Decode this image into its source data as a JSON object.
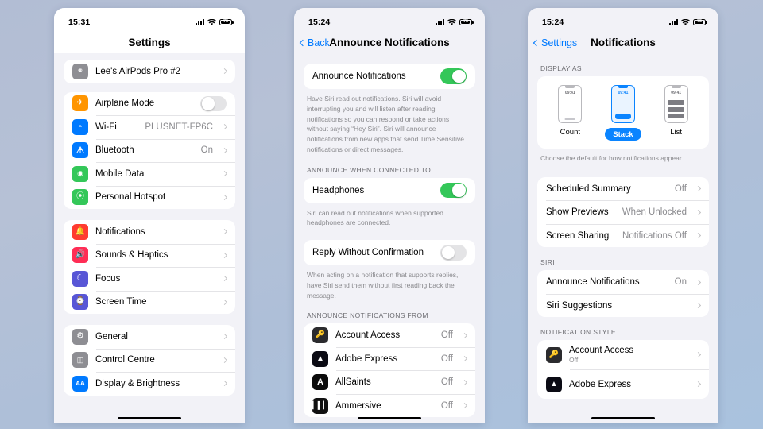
{
  "phones": [
    {
      "id": "settings-main",
      "status": {
        "time": "15:31",
        "battery": "75"
      },
      "nav": {
        "title": "Settings"
      },
      "device_card": {
        "label": "Lee's AirPods Pro #2",
        "icon": "airpods-icon"
      },
      "groups": [
        {
          "rows": [
            {
              "label": "Airplane Mode",
              "icon": "airplane-icon",
              "icon_color": "#ff9500",
              "glyph": "✈",
              "control": "switch",
              "on": false
            },
            {
              "label": "Wi-Fi",
              "icon": "wifi-icon",
              "icon_color": "#007aff",
              "glyph": "◔",
              "value": "PLUSNET-FP6C",
              "control": "chevron"
            },
            {
              "label": "Bluetooth",
              "icon": "bluetooth-icon",
              "icon_color": "#007aff",
              "glyph": "ᛗ",
              "value": "On",
              "control": "chevron"
            },
            {
              "label": "Mobile Data",
              "icon": "mobile-data-icon",
              "icon_color": "#34c759",
              "glyph": "≈",
              "value": "",
              "control": "chevron"
            },
            {
              "label": "Personal Hotspot",
              "icon": "hotspot-icon",
              "icon_color": "#34c759",
              "glyph": "@",
              "value": "",
              "control": "chevron"
            }
          ]
        },
        {
          "rows": [
            {
              "label": "Notifications",
              "icon": "notifications-bell-icon",
              "icon_color": "#ff3b30",
              "glyph": "ὑ4",
              "value": "",
              "control": "chevron"
            },
            {
              "label": "Sounds & Haptics",
              "icon": "sounds-icon",
              "icon_color": "#ff2d55",
              "glyph": "ὐA",
              "value": "",
              "control": "chevron"
            },
            {
              "label": "Focus",
              "icon": "focus-moon-icon",
              "icon_color": "#5856d6",
              "glyph": "☾",
              "value": "",
              "control": "chevron"
            },
            {
              "label": "Screen Time",
              "icon": "screen-time-icon",
              "icon_color": "#5856d6",
              "glyph": "⏳",
              "value": "",
              "control": "chevron"
            }
          ]
        },
        {
          "rows": [
            {
              "label": "General",
              "icon": "gear-icon",
              "icon_color": "#8e8e93",
              "glyph": "⚙",
              "value": "",
              "control": "chevron"
            },
            {
              "label": "Control Centre",
              "icon": "control-centre-icon",
              "icon_color": "#8e8e93",
              "glyph": "☰",
              "value": "",
              "control": "chevron"
            },
            {
              "label": "Display & Brightness",
              "icon": "display-brightness-icon",
              "icon_color": "#007aff",
              "glyph": "AA",
              "value": "",
              "control": "chevron"
            }
          ]
        }
      ]
    },
    {
      "id": "announce-notifications",
      "status": {
        "time": "15:24",
        "battery": "75"
      },
      "nav": {
        "back_label": "Back",
        "title": "Announce Notifications"
      },
      "main_toggle": {
        "label": "Announce Notifications",
        "on": true
      },
      "main_footnote": "Have Siri read out notifications. Siri will avoid interrupting you and will listen after reading notifications so you can respond or take actions without saying “Hey Siri”. Siri will announce notifications from new apps that send Time Sensitive notifications or direct messages.",
      "connected_header": "ANNOUNCE WHEN CONNECTED TO",
      "headphones": {
        "label": "Headphones",
        "on": true
      },
      "headphones_footnote": "Siri can read out notifications when supported headphones are connected.",
      "reply": {
        "label": "Reply Without Confirmation",
        "on": false
      },
      "reply_footnote": "When acting on a notification that supports replies, have Siri send them without first reading back the message.",
      "apps_header": "ANNOUNCE NOTIFICATIONS FROM",
      "apps": [
        {
          "label": "Account Access",
          "value": "Off",
          "icon": "account-access-app-icon"
        },
        {
          "label": "Adobe Express",
          "value": "Off",
          "icon": "adobe-express-app-icon"
        },
        {
          "label": "AllSaints",
          "value": "Off",
          "icon": "allsaints-app-icon"
        },
        {
          "label": "Ammersive",
          "value": "Off",
          "icon": "ammersive-app-icon"
        }
      ]
    },
    {
      "id": "notifications",
      "status": {
        "time": "15:24",
        "battery": "75"
      },
      "nav": {
        "back_label": "Settings",
        "title": "Notifications"
      },
      "display_as_header": "DISPLAY AS",
      "display_as_options": [
        {
          "label": "Count",
          "time": "09:41",
          "selected": false
        },
        {
          "label": "Stack",
          "time": "09:41",
          "selected": true
        },
        {
          "label": "List",
          "time": "09:41",
          "selected": false
        }
      ],
      "display_as_footnote": "Choose the default for how notifications appear.",
      "settings_rows": [
        {
          "label": "Scheduled Summary",
          "value": "Off"
        },
        {
          "label": "Show Previews",
          "value": "When Unlocked"
        },
        {
          "label": "Screen Sharing",
          "value": "Notifications Off"
        }
      ],
      "siri_header": "SIRI",
      "siri_rows": [
        {
          "label": "Announce Notifications",
          "value": "On"
        },
        {
          "label": "Siri Suggestions",
          "value": ""
        }
      ],
      "style_header": "NOTIFICATION STYLE",
      "style_rows": [
        {
          "label": "Account Access",
          "sub": "Off",
          "icon": "account-access-app-icon"
        },
        {
          "label": "Adobe Express",
          "sub": "",
          "icon": "adobe-express-app-icon"
        }
      ]
    }
  ]
}
